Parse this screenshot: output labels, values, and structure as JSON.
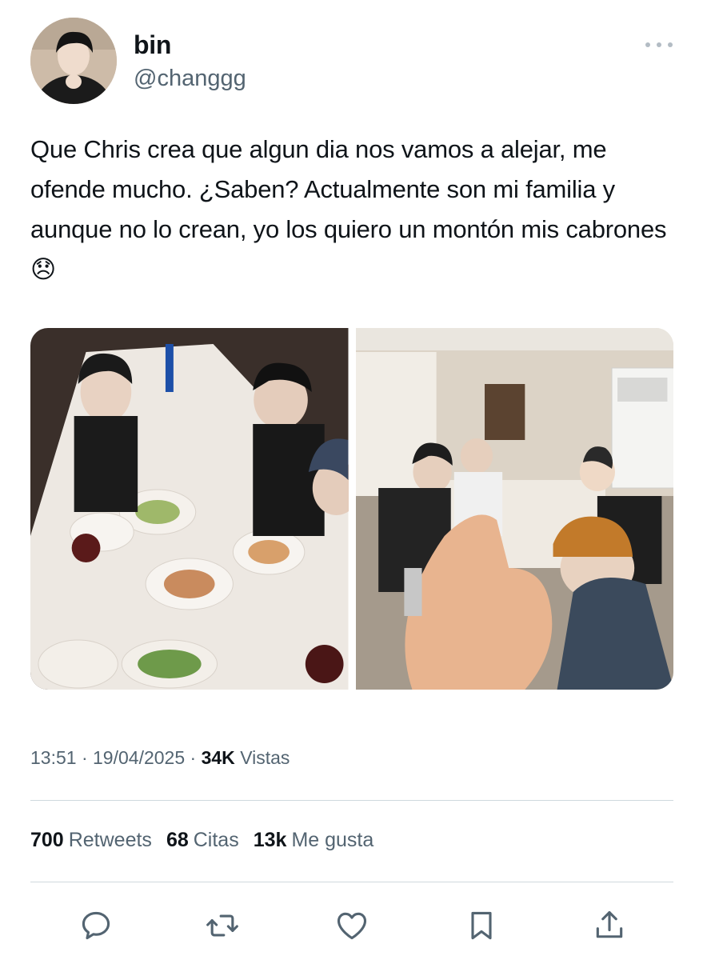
{
  "user": {
    "display_name": "bin",
    "handle": "@changgg"
  },
  "tweet": {
    "text": "Que Chris crea que algun dia nos vamos a alejar, me ofende mucho. ¿Saben? Actualmente son mi familia y aunque no lo crean, yo los quiero un montón mis cabrones",
    "emoji": "😞"
  },
  "meta": {
    "time": "13:51",
    "date": "19/04/2025",
    "views_count": "34K",
    "views_label": "Vistas",
    "separator": "·"
  },
  "stats": {
    "retweets_count": "700",
    "retweets_label": "Retweets",
    "quotes_count": "68",
    "quotes_label": "Citas",
    "likes_count": "13k",
    "likes_label": "Me gusta"
  },
  "icons": {
    "more": "more-horizontal-icon",
    "reply": "reply-icon",
    "retweet": "retweet-icon",
    "like": "heart-icon",
    "bookmark": "bookmark-icon",
    "share": "share-icon"
  },
  "colors": {
    "text": "#0f1419",
    "secondary": "#536471",
    "divider": "#cfd9de",
    "icon": "#536471"
  }
}
